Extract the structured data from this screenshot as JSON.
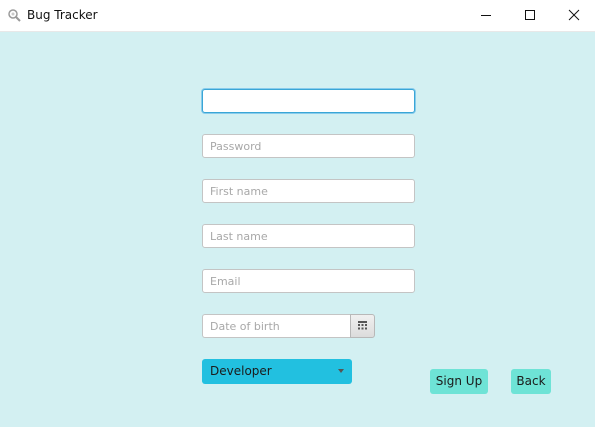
{
  "window": {
    "title": "Bug Tracker",
    "icon": "bug-magnifier-icon"
  },
  "form": {
    "username": {
      "value": "",
      "placeholder": ""
    },
    "password": {
      "value": "",
      "placeholder": "Password"
    },
    "first_name": {
      "value": "",
      "placeholder": "First name"
    },
    "last_name": {
      "value": "",
      "placeholder": "Last name"
    },
    "email": {
      "value": "",
      "placeholder": "Email"
    },
    "dob": {
      "value": "",
      "placeholder": "Date of birth",
      "picker_icon": "calendar-icon"
    },
    "role": {
      "selected": "Developer"
    }
  },
  "buttons": {
    "sign_up": "Sign Up",
    "back": "Back"
  },
  "colors": {
    "background": "#d3f0f2",
    "select_accent": "#22c0e0",
    "button_accent": "#6ee3d6",
    "focus_border": "#3aa6d6"
  }
}
